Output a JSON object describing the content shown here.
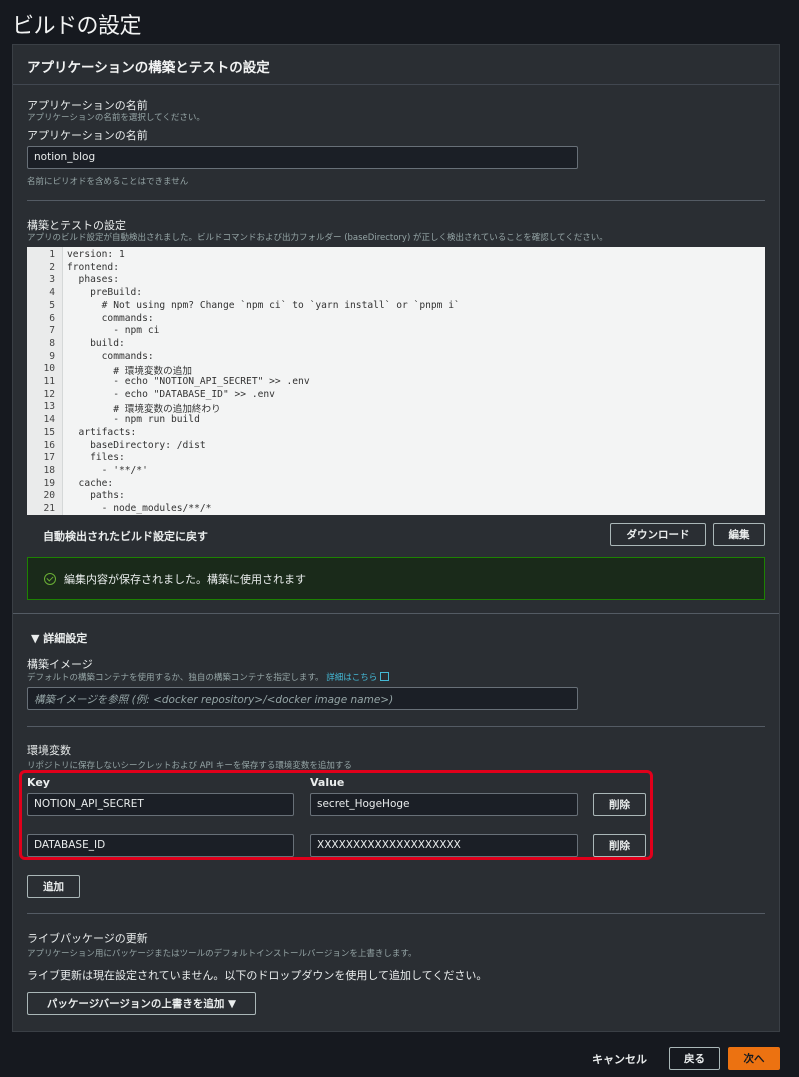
{
  "page": {
    "title": "ビルドの設定"
  },
  "panel": {
    "title": "アプリケーションの構築とテストの設定"
  },
  "app_name": {
    "section_label": "アプリケーションの名前",
    "section_desc": "アプリケーションの名前を選択してください。",
    "field_label": "アプリケーションの名前",
    "value": "notion_blog",
    "hint": "名前にピリオドを含めることはできません"
  },
  "build": {
    "label": "構築とテストの設定",
    "desc": "アプリのビルド設定が自動検出されました。ビルドコマンドおよび出力フォルダー (baseDirectory) が正しく検出されていることを確認してください。",
    "lines": [
      {
        "n": "1",
        "t": "version: 1"
      },
      {
        "n": "2",
        "t": "frontend:"
      },
      {
        "n": "3",
        "t": "  phases:"
      },
      {
        "n": "4",
        "t": "    preBuild:"
      },
      {
        "n": "5",
        "t": "      # Not using npm? Change `npm ci` to `yarn install` or `pnpm i`"
      },
      {
        "n": "6",
        "t": "      commands:"
      },
      {
        "n": "7",
        "t": "        - npm ci"
      },
      {
        "n": "8",
        "t": "    build:"
      },
      {
        "n": "9",
        "t": "      commands:"
      },
      {
        "n": "10",
        "t": "        # 環境変数の追加"
      },
      {
        "n": "11",
        "t": "        - echo \"NOTION_API_SECRET\" >> .env"
      },
      {
        "n": "12",
        "t": "        - echo \"DATABASE_ID\" >> .env"
      },
      {
        "n": "13",
        "t": "        # 環境変数の追加終わり"
      },
      {
        "n": "14",
        "t": "        - npm run build"
      },
      {
        "n": "15",
        "t": "  artifacts:"
      },
      {
        "n": "16",
        "t": "    baseDirectory: /dist"
      },
      {
        "n": "17",
        "t": "    files:"
      },
      {
        "n": "18",
        "t": "      - '**/*'"
      },
      {
        "n": "19",
        "t": "  cache:"
      },
      {
        "n": "20",
        "t": "    paths:"
      },
      {
        "n": "21",
        "t": "      - node_modules/**/*"
      }
    ],
    "revert_label": "自動検出されたビルド設定に戻す",
    "download_label": "ダウンロード",
    "edit_label": "編集",
    "saved_message": "編集内容が保存されました。構築に使用されます"
  },
  "advanced": {
    "toggle_label": "▼ 詳細設定",
    "image_label": "構築イメージ",
    "image_desc": "デフォルトの構築コンテナを使用するか、独自の構築コンテナを指定します。",
    "image_link": "詳細はこちら",
    "image_placeholder": "構築イメージを参照 (例: <docker repository>/<docker image name>)",
    "env_label": "環境変数",
    "env_desc": "リポジトリに保存しないシークレットおよび API キーを保存する環境変数を追加する",
    "key_header": "Key",
    "value_header": "Value",
    "env_rows": [
      {
        "key": "NOTION_API_SECRET",
        "value": "secret_HogeHoge",
        "delete": "削除"
      },
      {
        "key": "DATABASE_ID",
        "value": "XXXXXXXXXXXXXXXXXXXX",
        "delete": "削除"
      }
    ],
    "add_label": "追加",
    "live_label": "ライブパッケージの更新",
    "live_desc": "アプリケーション用にパッケージまたはツールのデフォルトインストールバージョンを上書きします。",
    "live_status": "ライブ更新は現在設定されていません。以下のドロップダウンを使用して追加してください。",
    "override_label": "パッケージバージョンの上書きを追加 ▼"
  },
  "footer": {
    "cancel": "キャンセル",
    "back": "戻る",
    "next": "次へ"
  },
  "colors": {
    "accent": "#ec7211",
    "success": "#1d8102",
    "highlight": "#e0001b",
    "link": "#44b9d6"
  }
}
